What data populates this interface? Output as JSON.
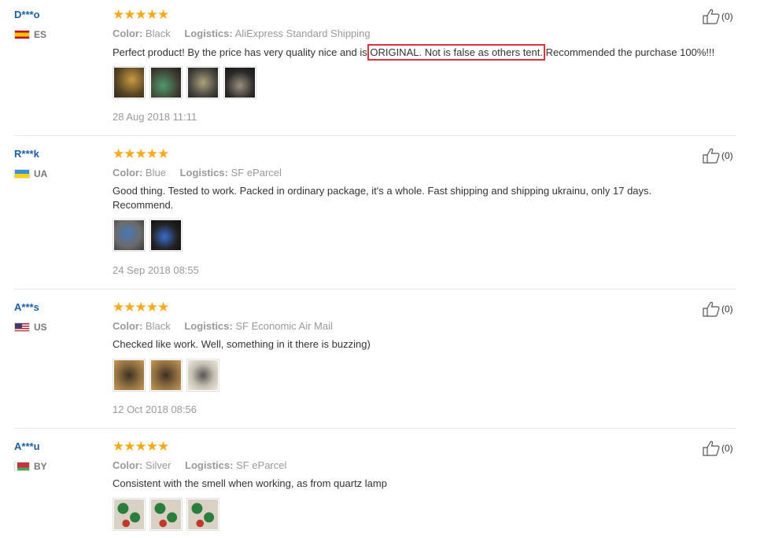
{
  "reviews": [
    {
      "user": "D***o",
      "country": "ES",
      "flag": "flag-es",
      "stars": "★★★★★",
      "color_label": "Color:",
      "color": "Black",
      "logistics_label": "Logistics:",
      "logistics": "AliExpress Standard Shipping",
      "text_before": "Perfect product! By the price has very quality nice and is ",
      "text_highlight": "ORIGINAL. Not is false as others tent.",
      "text_after": " Recommended the purchase 100%!!!",
      "date": "28 Aug 2018 11:11",
      "likes": "(0)",
      "photos": [
        "t-gold",
        "t-green",
        "t-gray",
        "t-dark"
      ]
    },
    {
      "user": "R***k",
      "country": "UA",
      "flag": "flag-ua",
      "stars": "★★★★★",
      "color_label": "Color:",
      "color": "Blue",
      "logistics_label": "Logistics:",
      "logistics": "SF eParcel",
      "text": "Good thing. Tested to work. Packed in ordinary package, it's a whole. Fast shipping and shipping ukrainu, only 17 days. Recommend.",
      "date": "24 Sep 2018 08:55",
      "likes": "(0)",
      "photos": [
        "t-blue",
        "t-night"
      ]
    },
    {
      "user": "A***s",
      "country": "US",
      "flag": "flag-us",
      "stars": "★★★★★",
      "color_label": "Color:",
      "color": "Black",
      "logistics_label": "Logistics:",
      "logistics": "SF Economic Air Mail",
      "text": "Checked like work. Well, something in it there is buzzing)",
      "date": "12 Oct 2018 08:56",
      "likes": "(0)",
      "photos": [
        "t-warm",
        "t-warm",
        "t-white"
      ]
    },
    {
      "user": "A***u",
      "country": "BY",
      "flag": "flag-by",
      "stars": "★★★★★",
      "color_label": "Color:",
      "color": "Silver",
      "logistics_label": "Logistics:",
      "logistics": "SF eParcel",
      "text": "Consistent with the smell when working, as from quartz lamp",
      "likes": "(0)",
      "photos": [
        "t-leaf",
        "t-leaf",
        "t-leaf"
      ]
    }
  ]
}
